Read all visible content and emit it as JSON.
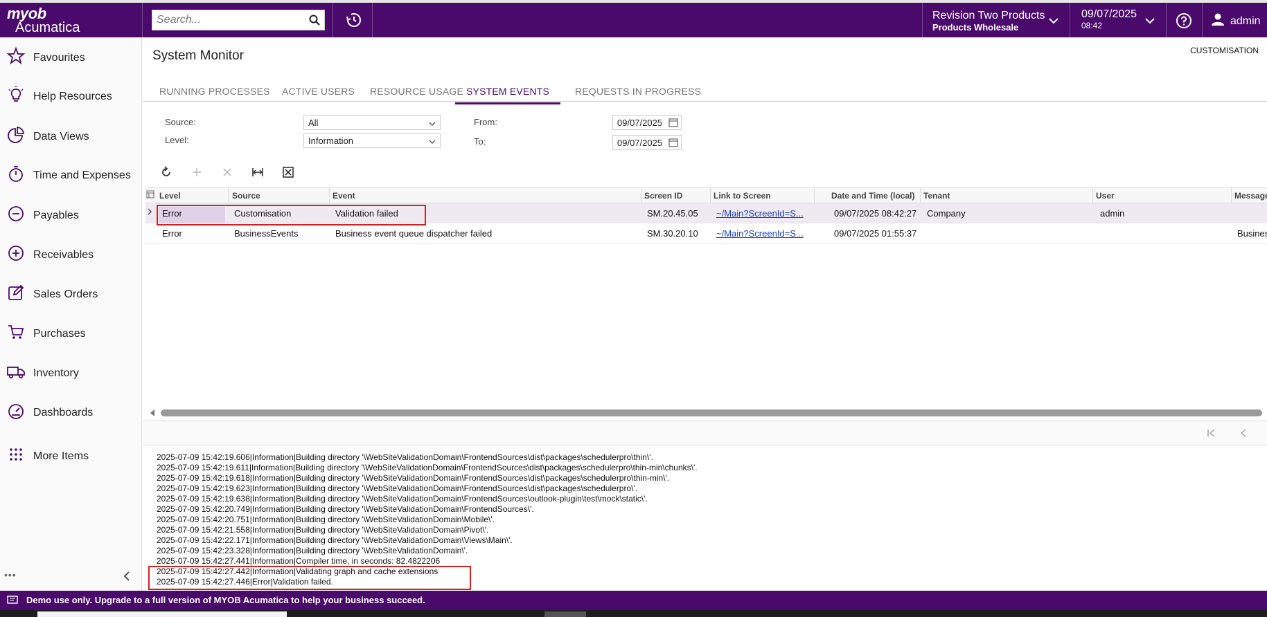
{
  "header": {
    "logo_line1": "myob",
    "logo_line2": "Acumatica",
    "search_placeholder": "Search...",
    "company_name": "Revision Two Products",
    "company_branch": "Products Wholesale",
    "date": "09/07/2025",
    "time": "08:42",
    "user": "admin",
    "accent_color": "#4a0a6b"
  },
  "sidebar": {
    "items": [
      {
        "label": "Favourites",
        "icon": "star-icon"
      },
      {
        "label": "Help Resources",
        "icon": "lightbulb-icon"
      },
      {
        "label": "Data Views",
        "icon": "pie-chart-icon"
      },
      {
        "label": "Time and Expenses",
        "icon": "stopwatch-icon"
      },
      {
        "label": "Payables",
        "icon": "minus-circle-icon"
      },
      {
        "label": "Receivables",
        "icon": "plus-circle-icon"
      },
      {
        "label": "Sales Orders",
        "icon": "pencil-square-icon"
      },
      {
        "label": "Purchases",
        "icon": "cart-icon"
      },
      {
        "label": "Inventory",
        "icon": "truck-icon"
      },
      {
        "label": "Dashboards",
        "icon": "gauge-icon"
      },
      {
        "label": "More Items",
        "icon": "grid-dots-icon"
      }
    ]
  },
  "page": {
    "title": "System Monitor",
    "customisation": "CUSTOMISATION"
  },
  "tabs": [
    {
      "label": "RUNNING PROCESSES",
      "active": false
    },
    {
      "label": "ACTIVE USERS",
      "active": false
    },
    {
      "label": "RESOURCE USAGE",
      "active": false
    },
    {
      "label": "SYSTEM EVENTS",
      "active": true
    },
    {
      "label": "REQUESTS IN PROGRESS",
      "active": false
    }
  ],
  "filters": {
    "source_label": "Source:",
    "source_value": "All",
    "level_label": "Level:",
    "level_value": "Information",
    "from_label": "From:",
    "from_value": "09/07/2025",
    "to_label": "To:",
    "to_value": "09/07/2025"
  },
  "grid": {
    "columns": [
      "Level",
      "Source",
      "Event",
      "Screen ID",
      "Link to Screen",
      "Date and Time (local)",
      "Tenant",
      "User",
      "Message"
    ],
    "rows": [
      [
        "Error",
        "Customisation",
        "Validation failed",
        "SM.20.45.05",
        "~/Main?ScreenId=S...",
        "09/07/2025 08:42:27",
        "Company",
        "admin",
        ""
      ],
      [
        "Error",
        "BusinessEvents",
        "Business event queue dispatcher failed",
        "SM.30.20.10",
        "~/Main?ScreenId=S...",
        "09/07/2025 01:55:37",
        "",
        "",
        "Busines"
      ]
    ]
  },
  "log_lines": [
    "2025-07-09 15:42:19.606|Information|Building directory '\\WebSiteValidationDomain\\FrontendSources\\dist\\packages\\schedulerpro\\thin\\'.",
    "2025-07-09 15:42:19.611|Information|Building directory '\\WebSiteValidationDomain\\FrontendSources\\dist\\packages\\schedulerpro\\thin-min\\chunks\\'.",
    "2025-07-09 15:42:19.618|Information|Building directory '\\WebSiteValidationDomain\\FrontendSources\\dist\\packages\\schedulerpro\\thin-min\\'.",
    "2025-07-09 15:42:19.623|Information|Building directory '\\WebSiteValidationDomain\\FrontendSources\\dist\\packages\\schedulerpro\\'.",
    "2025-07-09 15:42:19.638|Information|Building directory '\\WebSiteValidationDomain\\FrontendSources\\outlook-plugin\\test\\mock\\static\\'.",
    "2025-07-09 15:42:20.749|Information|Building directory '\\WebSiteValidationDomain\\FrontendSources\\'.",
    "2025-07-09 15:42:20.751|Information|Building directory '\\WebSiteValidationDomain\\Mobile\\'.",
    "2025-07-09 15:42:21.558|Information|Building directory '\\WebSiteValidationDomain\\Pivot\\'.",
    "2025-07-09 15:42:22.171|Information|Building directory '\\WebSiteValidationDomain\\Views\\Main\\'.",
    "2025-07-09 15:42:23.328|Information|Building directory '\\WebSiteValidationDomain\\'.",
    "2025-07-09 15:42:27.441|Information|Compiler time, in seconds: 82.4822206",
    "2025-07-09 15:42:27.442|Information|Validating graph and cache extensions",
    "2025-07-09 15:42:27.446|Error|Validation failed."
  ],
  "banner": {
    "text": "Demo use only. Upgrade to a full version of MYOB Acumatica to help your business succeed."
  }
}
